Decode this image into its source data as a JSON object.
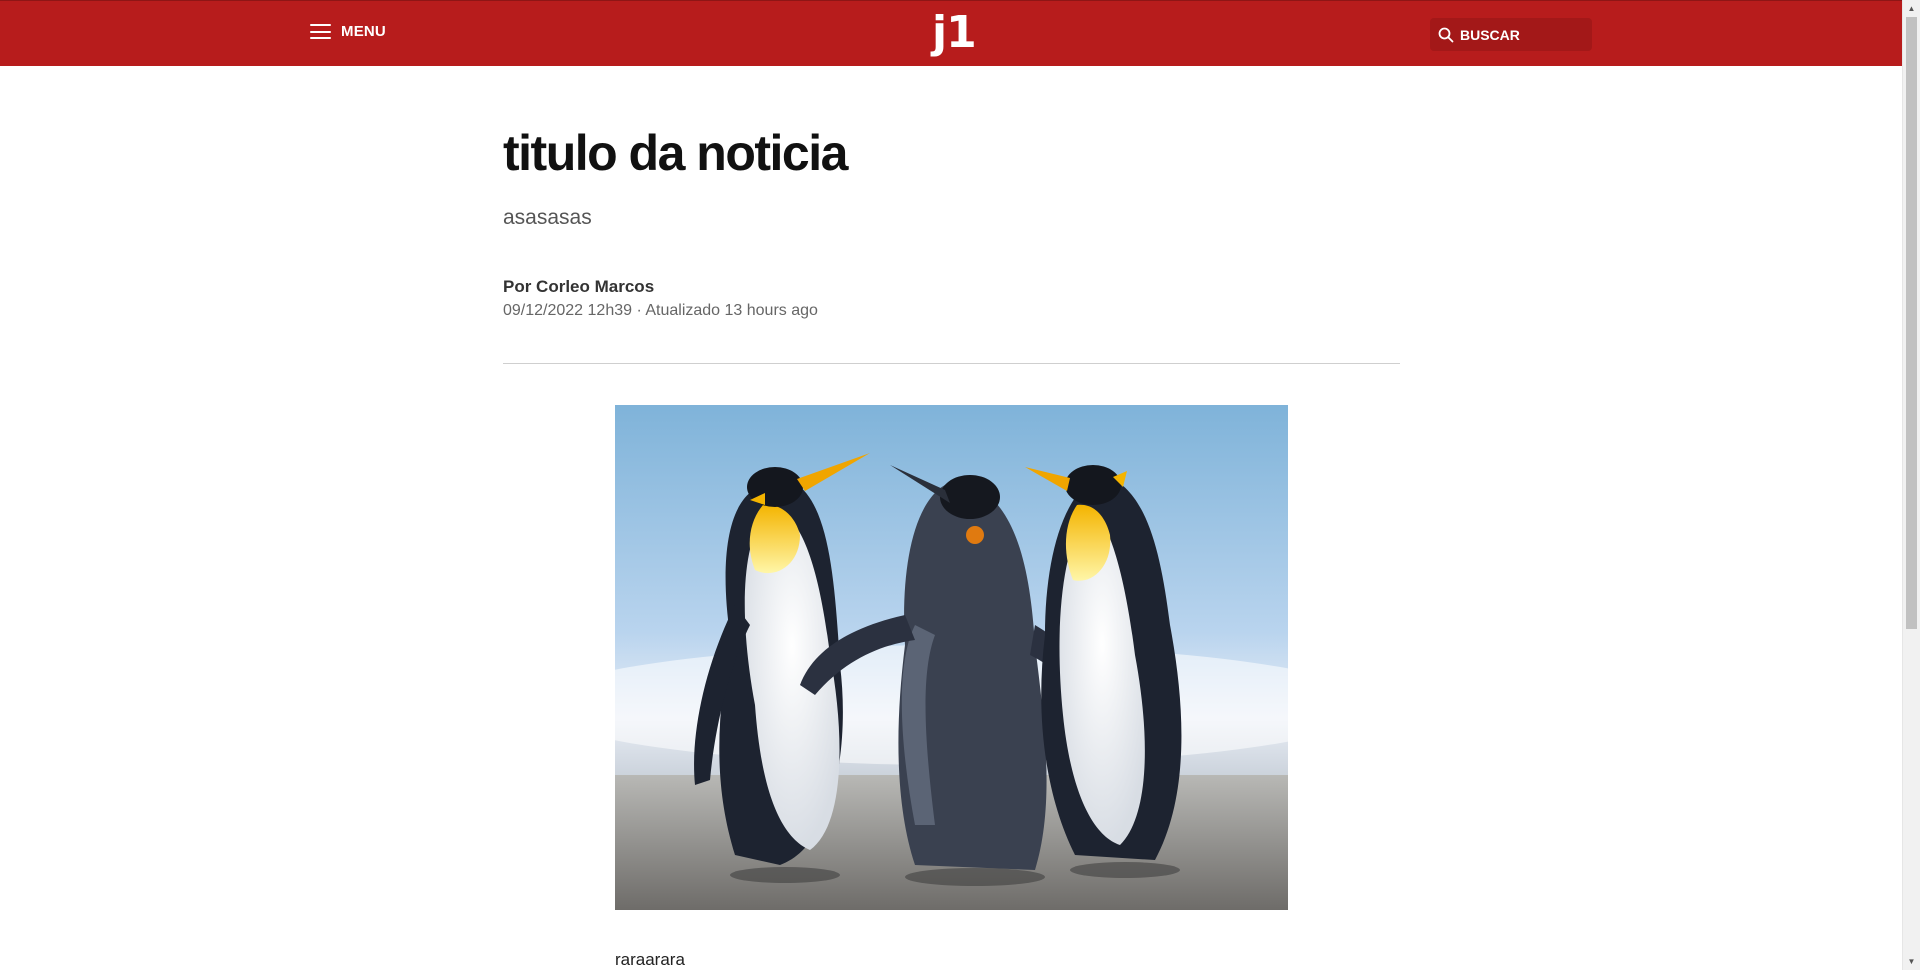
{
  "header": {
    "menu_label": "MENU",
    "logo_text": "j1",
    "search_label": "BUSCAR",
    "brand_color": "#b71c1c"
  },
  "article": {
    "title": "titulo da noticia",
    "subtitle": "asasasas",
    "byline": "Por Corleo Marcos",
    "dateline": "09/12/2022 12h39 · Atualizado 13 hours ago",
    "body_paragraph": "raraarara"
  },
  "icons": {
    "menu": "hamburger-icon",
    "search": "search-icon"
  }
}
